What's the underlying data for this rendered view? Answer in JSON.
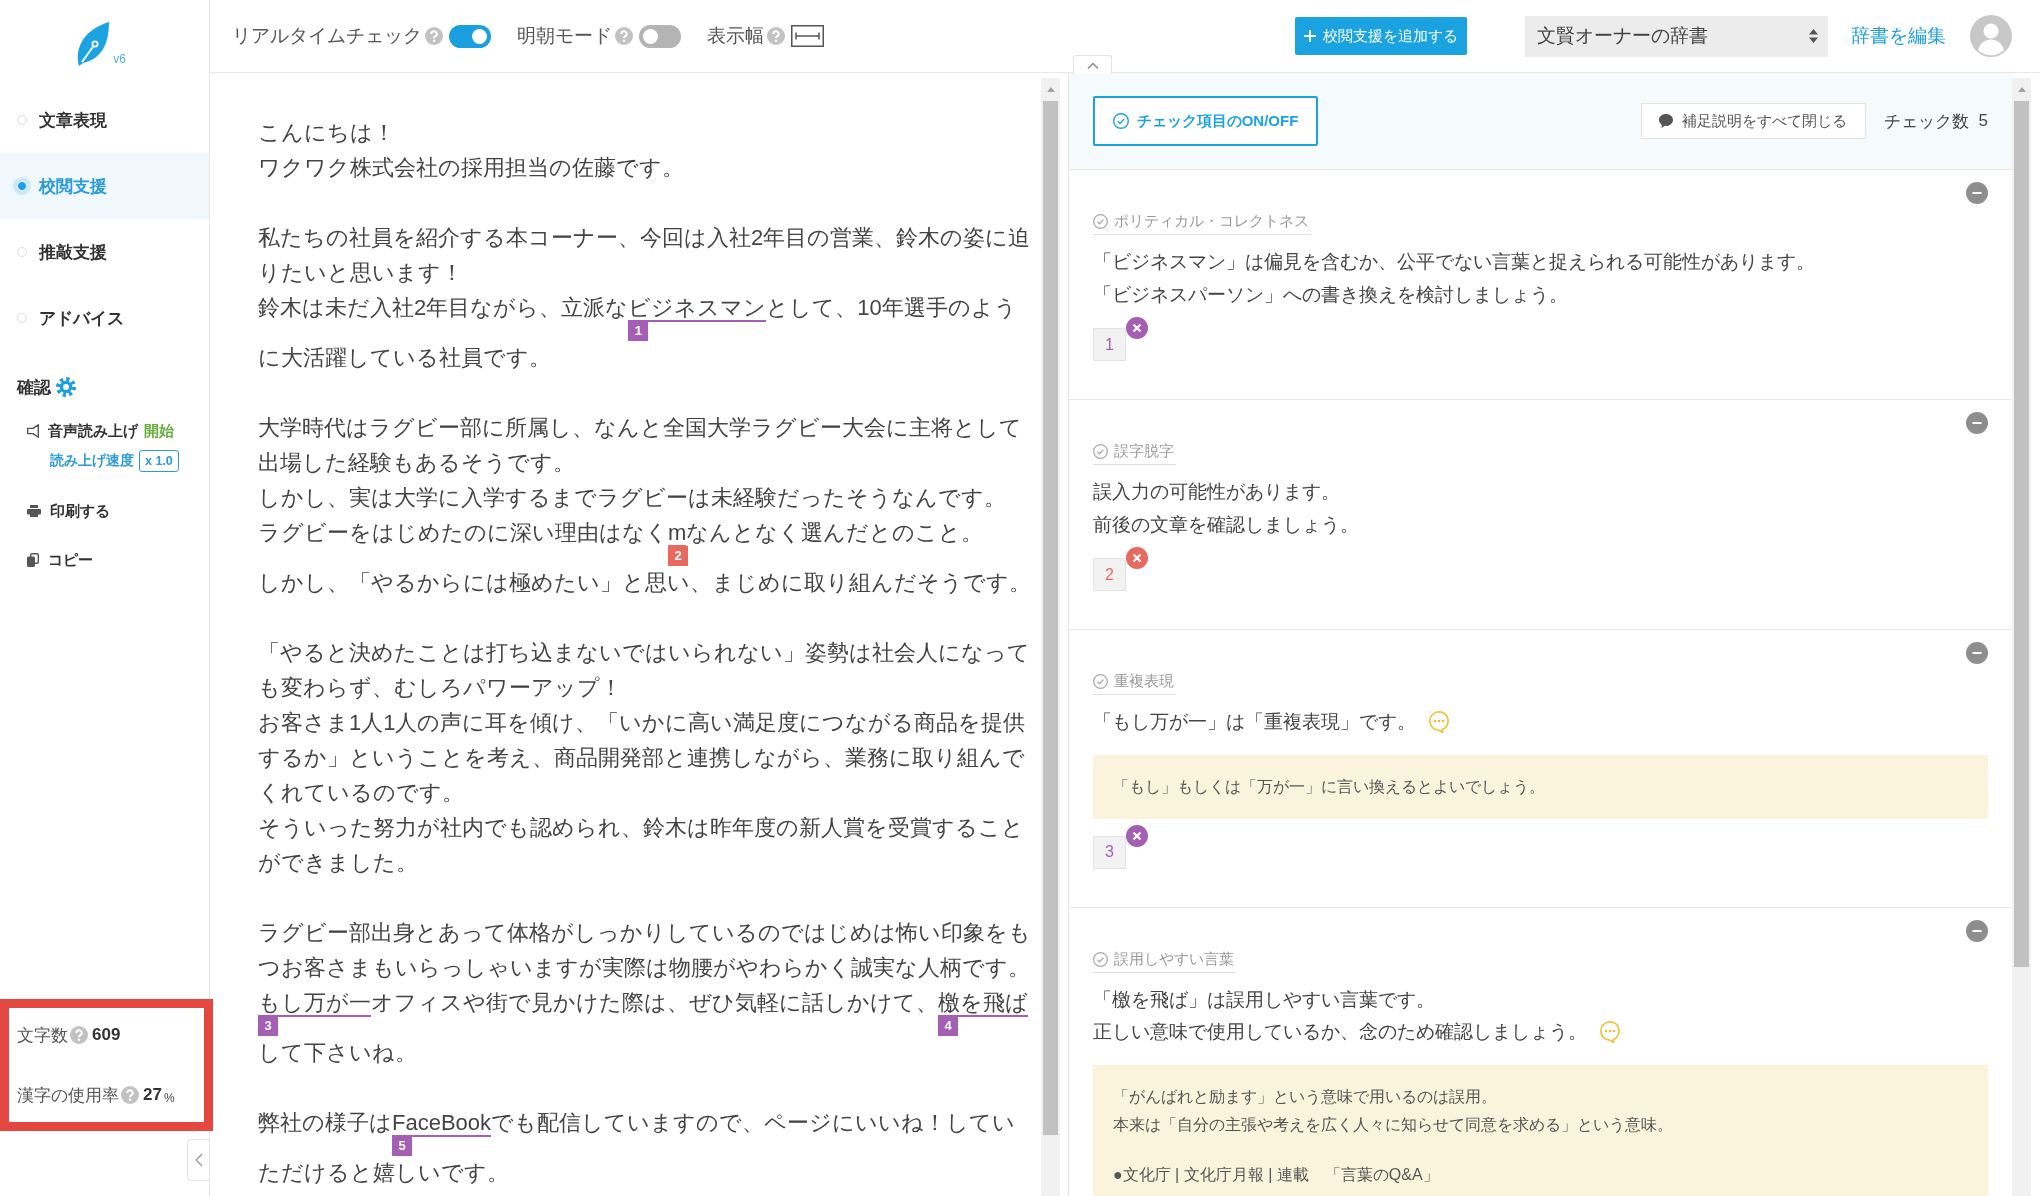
{
  "sidebar": {
    "logo": {
      "version": "v6"
    },
    "nav_items": [
      {
        "label": "文章表現",
        "selected": false
      },
      {
        "label": "校閲支援",
        "selected": true
      },
      {
        "label": "推敲支援",
        "selected": false
      },
      {
        "label": "アドバイス",
        "selected": false
      }
    ],
    "confirm": {
      "title": "確認",
      "tools": [
        {
          "kind": "speech",
          "label": "音声読み上げ",
          "action": "開始",
          "speed_label": "読み上げ速度",
          "speed": "x 1.0"
        },
        {
          "kind": "print",
          "label": "印刷する"
        },
        {
          "kind": "copy",
          "label": "コピー"
        }
      ]
    },
    "stats": [
      {
        "label": "文字数",
        "value": "609"
      },
      {
        "label": "漢字の使用率",
        "value": "27",
        "unit": "%"
      }
    ]
  },
  "toolbar": {
    "options": [
      {
        "kind": "toggle",
        "label": "リアルタイムチェック",
        "on": true
      },
      {
        "kind": "toggle",
        "label": "明朝モード",
        "on": false
      },
      {
        "kind": "width",
        "label": "表示幅"
      }
    ],
    "add_button": "校閲支援を追加する",
    "dictionary_select": "文賢オーナーの辞書",
    "edit_link": "辞書を編集"
  },
  "editor": {
    "paragraphs": [
      [
        [
          {
            "kind": "text",
            "text": "こんにちは！"
          }
        ],
        [
          {
            "kind": "text",
            "text": "ワクワク株式会社の採用担当の佐藤です。"
          }
        ]
      ],
      [
        [
          {
            "kind": "text",
            "text": "私たちの社員を紹介する本コーナー、今回は入社2年目の営業、鈴木の姿に迫りたいと思います！"
          }
        ],
        [
          {
            "kind": "text",
            "text": "鈴木は未だ入社2年目ながら、立派な"
          },
          {
            "kind": "flag",
            "text": "ビジネスマン",
            "issue": "1",
            "color": "#a45fb5"
          },
          {
            "kind": "text",
            "text": "として、10年選手のように大活躍している社員です。"
          }
        ]
      ],
      [
        [
          {
            "kind": "text",
            "text": "大学時代はラグビー部に所属し、なんと全国大学ラグビー大会に主将として出場した経験もあるそうです。"
          }
        ],
        [
          {
            "kind": "text",
            "text": "しかし、実は大学に入学するまでラグビーは未経験だったそうなんです。"
          }
        ],
        [
          {
            "kind": "text",
            "text": "ラグビーをはじめたのに深い理由はなく"
          },
          {
            "kind": "flag",
            "text": "m",
            "issue": "2",
            "color": "#e9685f"
          },
          {
            "kind": "text",
            "text": "なんとなく選んだとのこと。"
          }
        ],
        [
          {
            "kind": "text",
            "text": "しかし、「やるからには極めたい」と思い、まじめに取り組んだそうです。"
          }
        ]
      ],
      [
        [
          {
            "kind": "text",
            "text": "「やると決めたことは打ち込まないではいられない」姿勢は社会人になっても変わらず、むしろパワーアップ！"
          }
        ],
        [
          {
            "kind": "text",
            "text": "お客さま1人1人の声に耳を傾け、「いかに高い満足度につながる商品を提供するか」ということを考え、商品開発部と連携しながら、業務に取り組んでくれているのです。"
          }
        ],
        [
          {
            "kind": "text",
            "text": "そういった努力が社内でも認められ、鈴木は昨年度の新人賞を受賞することができました。"
          }
        ]
      ],
      [
        [
          {
            "kind": "text",
            "text": "ラグビー部出身とあって体格がしっかりしているのではじめは怖い印象をもつお客さまもいらっしゃいますが実際は物腰がやわらかく誠実な人柄です。"
          }
        ],
        [
          {
            "kind": "flag",
            "text": "もし万が一",
            "issue": "3",
            "color": "#a45fb5"
          },
          {
            "kind": "text",
            "text": "オフィスや街で見かけた際は、ぜひ気軽に話しかけて、"
          },
          {
            "kind": "flag",
            "text": "檄を飛ば",
            "issue": "4",
            "color": "#a45fb5"
          },
          {
            "kind": "text",
            "text": "して下さいね。"
          }
        ]
      ],
      [
        [
          {
            "kind": "text",
            "text": "弊社の様子は"
          },
          {
            "kind": "flag",
            "text": "FaceBook",
            "issue": "5",
            "color": "#a45fb5"
          },
          {
            "kind": "text",
            "text": "でも配信していますので、ページにいいね！していただけると嬉しいです。"
          }
        ]
      ]
    ]
  },
  "review_panel": {
    "toggle_button": "チェック項目のON/OFF",
    "close_notes_button": "補足説明をすべて閉じる",
    "check_count_label": "チェック数",
    "check_count": "5",
    "cards": [
      {
        "category": "ポリティカル・コレクトネス",
        "messages": [
          "「ビジネスマン」は偏見を含むか、公平でない言葉と捉えられる可能性があります。",
          "「ビジネスパーソン」への書き換えを検討しましょう。"
        ],
        "comment_icon": false,
        "number": "1",
        "color": "#a45fb5"
      },
      {
        "category": "誤字脱字",
        "messages": [
          "誤入力の可能性があります。",
          "前後の文章を確認しましょう。"
        ],
        "comment_icon": false,
        "number": "2",
        "color": "#e9685f"
      },
      {
        "category": "重複表現",
        "messages": [
          "「もし万が一」は「重複表現」です。"
        ],
        "comment_icon": true,
        "note": [
          [
            "「もし」もしくは「万が一」に言い換えるとよいでしょう。"
          ]
        ],
        "number": "3",
        "color": "#a45fb5"
      },
      {
        "category": "誤用しやすい言葉",
        "messages": [
          "「檄を飛ば」は誤用しやすい言葉です。",
          "正しい意味で使用しているか、念のため確認しましょう。"
        ],
        "comment_icon": true,
        "note": [
          [
            "「がんばれと励ます」という意味で用いるのは誤用。",
            "本来は「自分の主張や考えを広く人々に知らせて同意を求める」という意味。"
          ],
          [
            "●文化庁 | 文化庁月報 | 連載　「言葉のQ&A」"
          ]
        ]
      }
    ]
  }
}
